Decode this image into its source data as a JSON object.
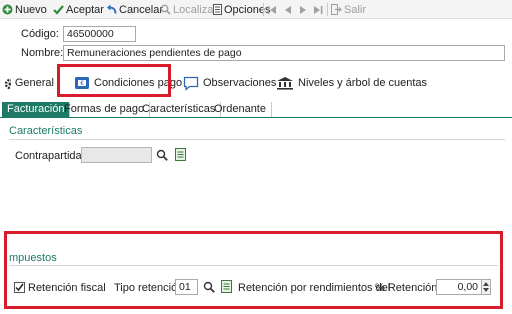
{
  "toolbar": {
    "nuevo": "Nuevo",
    "aceptar": "Aceptar",
    "cancelar": "Cancelar",
    "localizar": "Localizar",
    "opciones": "Opciones",
    "salir": "Salir"
  },
  "header": {
    "codigo_label": "Código:",
    "codigo_value": "46500000",
    "nombre_label": "Nombre:",
    "nombre_value": "Remuneraciones pendientes de pago"
  },
  "main_tabs": {
    "general": "General",
    "condiciones": "Condiciones pago",
    "observaciones": "Observaciones",
    "niveles": "Niveles y árbol de cuentas"
  },
  "sub_tabs": {
    "facturacion": "Facturación",
    "formas_pago": "Formas de pago",
    "caracteristicas": "Características",
    "ordenante": "Ordenante"
  },
  "caracteristicas": {
    "title": "Características",
    "contrapartida_label": "Contrapartida:",
    "contrapartida_value": ""
  },
  "impuestos": {
    "title": "mpuestos",
    "retencion_fiscal_label": "Retención fiscal",
    "retencion_fiscal_checked": true,
    "tipo_retencion_label": "Tipo retención:",
    "tipo_retencion_value": "01",
    "rendimientos_label": "Retención por rendimientos del",
    "pct_retencion_label": "% Retención:",
    "pct_retencion_value": "0,00"
  },
  "colors": {
    "accent": "#1c7a66",
    "highlight": "#d81c2b"
  }
}
